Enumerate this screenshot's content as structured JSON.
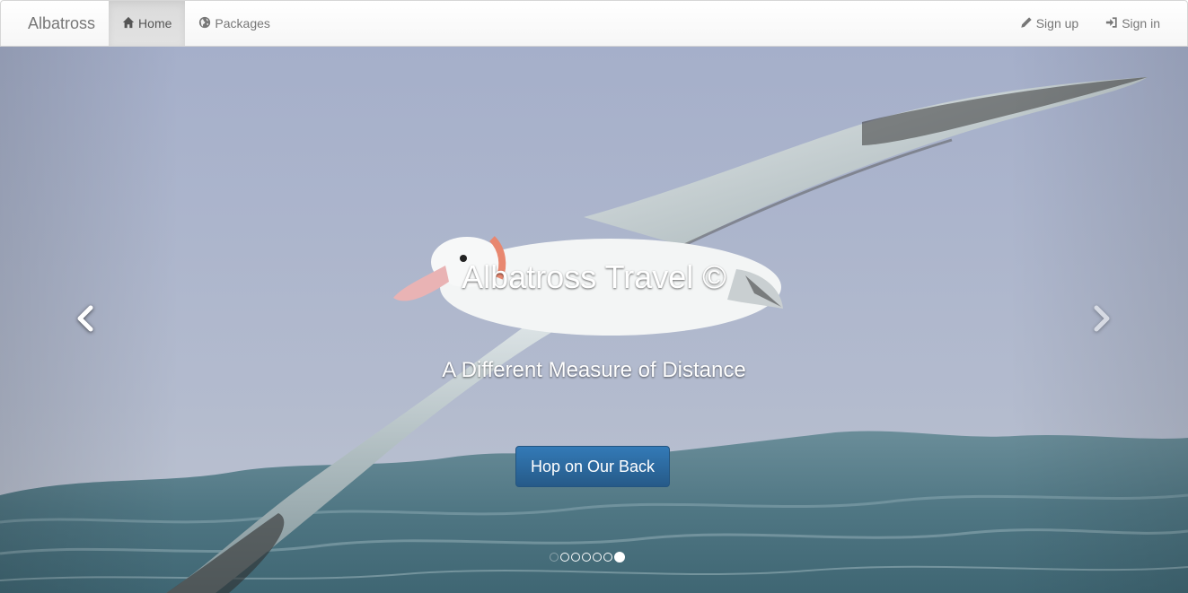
{
  "navbar": {
    "brand": "Albatross",
    "left_items": [
      {
        "label": "Home",
        "icon": "home-icon",
        "active": true
      },
      {
        "label": "Packages",
        "icon": "globe-icon",
        "active": false
      }
    ],
    "right_items": [
      {
        "label": "Sign up",
        "icon": "pencil-icon"
      },
      {
        "label": "Sign in",
        "icon": "log-in-icon"
      }
    ]
  },
  "carousel": {
    "title": "Albatross Travel ©",
    "subtitle": "A Different Measure of Distance",
    "button_label": "Hop on Our Back",
    "prev_icon": "chevron-left-icon",
    "next_icon": "chevron-right-icon",
    "indicator_count": 7,
    "active_indicator": 7
  },
  "colors": {
    "button": "#286090",
    "sky": "#a9b4cc",
    "sea": "#5a7f8c",
    "navbar_active": "#e0e0e0"
  }
}
